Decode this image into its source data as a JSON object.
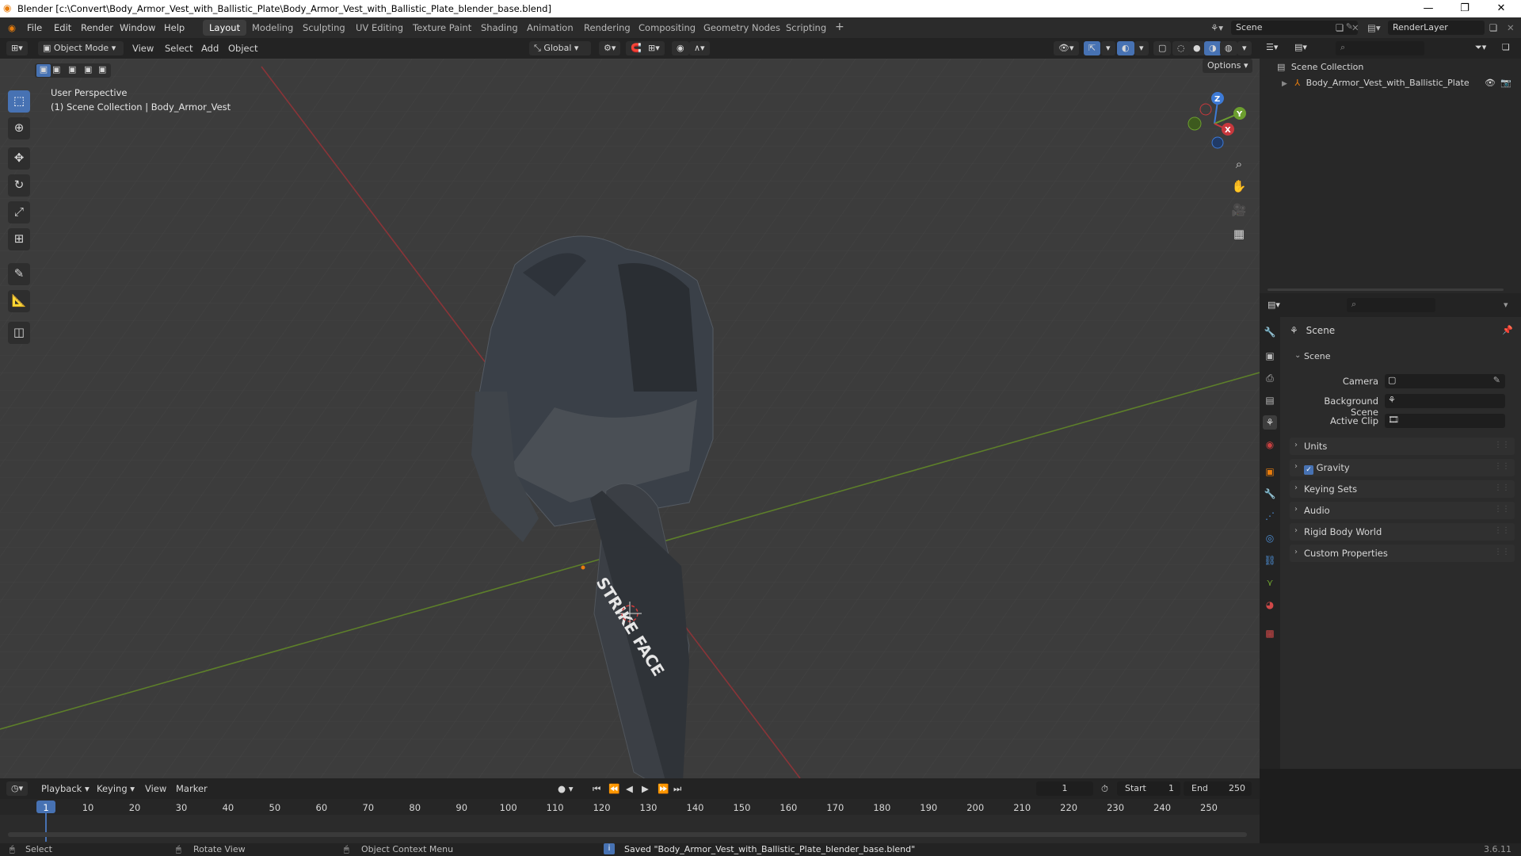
{
  "window": {
    "title": "Blender [c:\\Convert\\Body_Armor_Vest_with_Ballistic_Plate\\Body_Armor_Vest_with_Ballistic_Plate_blender_base.blend]",
    "controls": [
      "—",
      "❐",
      "✕"
    ]
  },
  "menubar": {
    "menus": [
      "File",
      "Edit",
      "Render",
      "Window",
      "Help"
    ],
    "workspaces": [
      "Layout",
      "Modeling",
      "Sculpting",
      "UV Editing",
      "Texture Paint",
      "Shading",
      "Animation",
      "Rendering",
      "Compositing",
      "Geometry Nodes",
      "Scripting"
    ],
    "active_workspace": "Layout",
    "add_tab": "+",
    "scene_name": "Scene",
    "view_layer": "RenderLayer"
  },
  "viewport_header": {
    "mode": "Object Mode",
    "menus": [
      "View",
      "Select",
      "Add",
      "Object"
    ],
    "transform_orientation": "Global",
    "options_label": "Options"
  },
  "viewport": {
    "perspective_label": "User Perspective",
    "collection_label": "(1) Scene Collection | Body_Armor_Vest",
    "plate_text": "STRIKE FACE",
    "gizmo_axes": [
      "Z",
      "Y",
      "X"
    ]
  },
  "outliner": {
    "root": "Scene Collection",
    "items": [
      {
        "name": "Body_Armor_Vest_with_Ballistic_Plate"
      }
    ]
  },
  "properties": {
    "header": "Scene",
    "section": "Scene",
    "fields": [
      {
        "label": "Camera"
      },
      {
        "label": "Background Scene"
      },
      {
        "label": "Active Clip"
      }
    ],
    "panels": [
      "Units",
      "Gravity",
      "Keying Sets",
      "Audio",
      "Rigid Body World",
      "Custom Properties"
    ],
    "gravity_checked": true
  },
  "timeline": {
    "menus": [
      "Playback",
      "Keying",
      "View",
      "Marker"
    ],
    "current_frame": "1",
    "start_label": "Start",
    "start": "1",
    "end_label": "End",
    "end": "250",
    "ticks": [
      "1",
      "10",
      "20",
      "30",
      "40",
      "50",
      "60",
      "70",
      "80",
      "90",
      "100",
      "110",
      "120",
      "130",
      "140",
      "150",
      "160",
      "170",
      "180",
      "190",
      "200",
      "210",
      "220",
      "230",
      "240",
      "250"
    ]
  },
  "statusbar": {
    "select": "Select",
    "rotate": "Rotate View",
    "context_menu": "Object Context Menu",
    "message": "Saved \"Body_Armor_Vest_with_Ballistic_Plate_blender_base.blend\"",
    "version": "3.6.11"
  },
  "colors": {
    "accent": "#4772b3",
    "x_axis": "#c8383d",
    "y_axis": "#6c9e2f",
    "z_axis": "#3d7ad6",
    "blender_orange": "#e87d0d"
  }
}
